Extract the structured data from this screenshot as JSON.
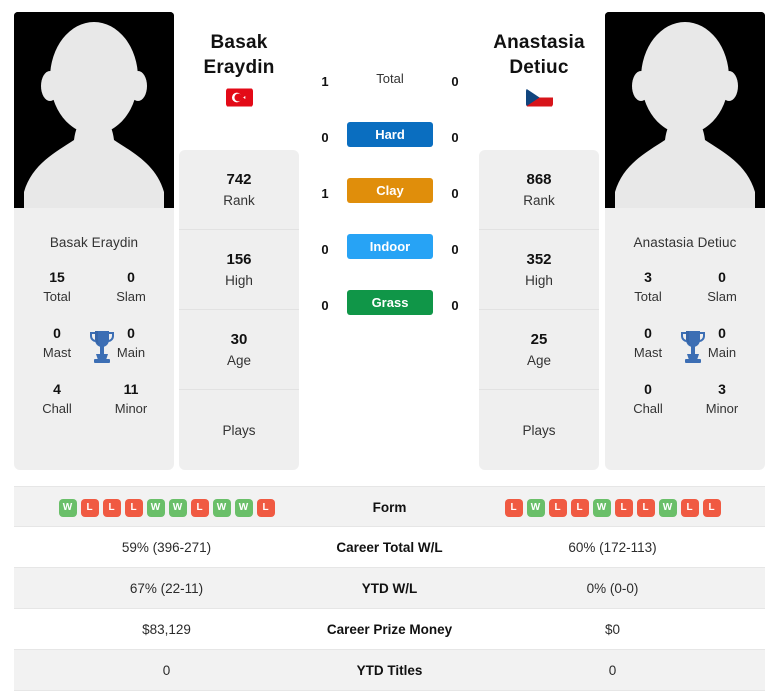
{
  "players": {
    "left": {
      "first_name": "Basak",
      "last_name": "Eraydin",
      "full_name": "Basak Eraydin",
      "flag": "turkey-flag",
      "photo": "player-photo-placeholder",
      "rank": "742",
      "rank_label": "Rank",
      "high": "156",
      "high_label": "High",
      "age": "30",
      "age_label": "Age",
      "plays": "Plays",
      "titles": {
        "total": "15",
        "total_label": "Total",
        "slam": "0",
        "slam_label": "Slam",
        "mast": "0",
        "mast_label": "Mast",
        "main": "0",
        "main_label": "Main",
        "chall": "4",
        "chall_label": "Chall",
        "minor": "11",
        "minor_label": "Minor"
      },
      "form": [
        "W",
        "L",
        "L",
        "L",
        "W",
        "W",
        "L",
        "W",
        "W",
        "L"
      ],
      "career_total_wl": "59% (396-271)",
      "ytd_wl": "67% (22-11)",
      "career_prize_money": "$83,129",
      "ytd_titles": "0"
    },
    "right": {
      "first_name": "Anastasia",
      "last_name": "Detiuc",
      "full_name": "Anastasia Detiuc",
      "flag": "czech-republic-flag",
      "photo": "player-photo-placeholder",
      "rank": "868",
      "rank_label": "Rank",
      "high": "352",
      "high_label": "High",
      "age": "25",
      "age_label": "Age",
      "plays": "Plays",
      "titles": {
        "total": "3",
        "total_label": "Total",
        "slam": "0",
        "slam_label": "Slam",
        "mast": "0",
        "mast_label": "Mast",
        "main": "0",
        "main_label": "Main",
        "chall": "0",
        "chall_label": "Chall",
        "minor": "3",
        "minor_label": "Minor"
      },
      "form": [
        "L",
        "W",
        "L",
        "L",
        "W",
        "L",
        "L",
        "W",
        "L",
        "L"
      ],
      "career_total_wl": "60% (172-113)",
      "ytd_wl": "0% (0-0)",
      "career_prize_money": "$0",
      "ytd_titles": "0"
    }
  },
  "head_to_head": {
    "rows": [
      {
        "label": "Total",
        "left": "1",
        "right": "0",
        "style": "plain",
        "color": ""
      },
      {
        "label": "Hard",
        "left": "0",
        "right": "0",
        "style": "pill",
        "color": "#0a6ec0"
      },
      {
        "label": "Clay",
        "left": "1",
        "right": "0",
        "style": "pill",
        "color": "#e08e0b"
      },
      {
        "label": "Indoor",
        "left": "0",
        "right": "0",
        "style": "pill",
        "color": "#27a3f5"
      },
      {
        "label": "Grass",
        "left": "0",
        "right": "0",
        "style": "pill",
        "color": "#109648"
      }
    ]
  },
  "stats_table": {
    "rows": [
      {
        "label": "Form",
        "type": "form"
      },
      {
        "label": "Career Total W/L",
        "type": "text",
        "left": "59% (396-271)",
        "right": "60% (172-113)"
      },
      {
        "label": "YTD W/L",
        "type": "text",
        "left": "67% (22-11)",
        "right": "0% (0-0)"
      },
      {
        "label": "Career Prize Money",
        "type": "text",
        "left": "$83,129",
        "right": "$0"
      },
      {
        "label": "YTD Titles",
        "type": "text",
        "left": "0",
        "right": "0"
      }
    ]
  },
  "colors": {
    "win_badge": "#6abf69",
    "loss_badge": "#f05a42",
    "card_bg": "#efefef",
    "row_shade": "#f2f2f2",
    "trophy": "#3c6eb4"
  }
}
